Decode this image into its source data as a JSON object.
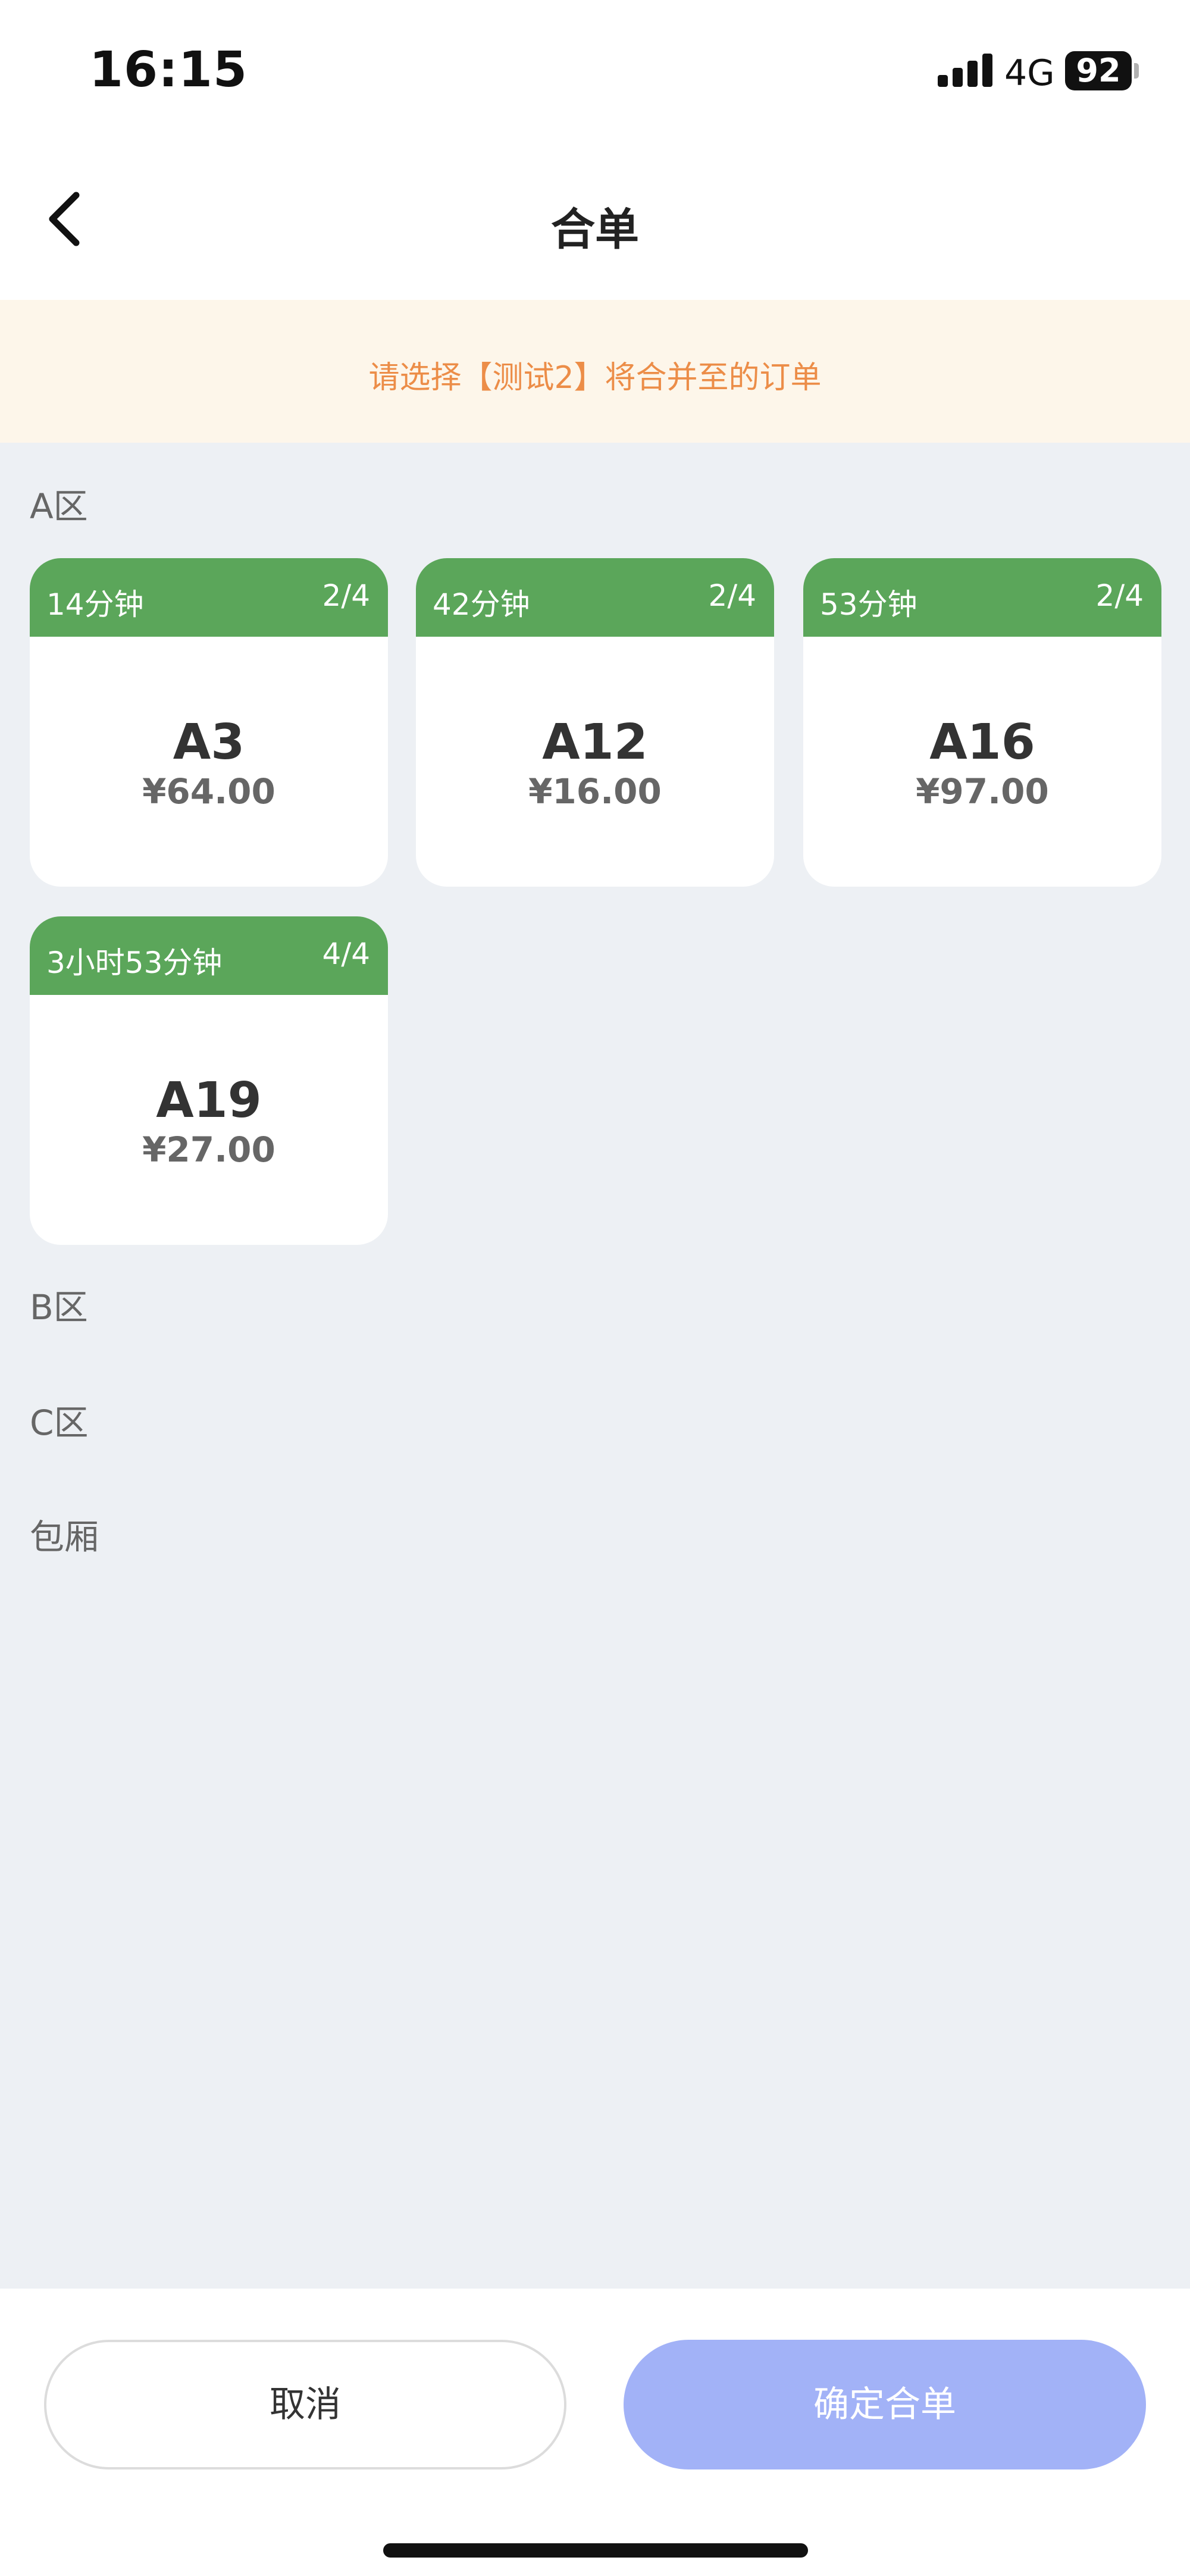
{
  "status_bar": {
    "time": "16:15",
    "network": "4G",
    "battery": "92"
  },
  "nav": {
    "title": "合单",
    "back_icon": "chevron-left-icon"
  },
  "notice": {
    "text": "请选择【测试2】将合并至的订单"
  },
  "zones": [
    {
      "label": "A区",
      "tables": [
        {
          "duration": "14分钟",
          "seats": "2/4",
          "name": "A3",
          "price": "¥64.00"
        },
        {
          "duration": "42分钟",
          "seats": "2/4",
          "name": "A12",
          "price": "¥16.00"
        },
        {
          "duration": "53分钟",
          "seats": "2/4",
          "name": "A16",
          "price": "¥97.00"
        },
        {
          "duration": "3小时53分钟",
          "seats": "4/4",
          "name": "A19",
          "price": "¥27.00"
        }
      ]
    },
    {
      "label": "B区",
      "tables": []
    },
    {
      "label": "C区",
      "tables": []
    },
    {
      "label": "包厢",
      "tables": []
    }
  ],
  "actions": {
    "cancel_label": "取消",
    "confirm_label": "确定合单"
  },
  "colors": {
    "card_header": "#5ba65a",
    "notice_text": "#ec8d48",
    "notice_bg": "#fdf6ea",
    "confirm_button": "#a2b2f7",
    "page_bg": "#edf0f4"
  }
}
